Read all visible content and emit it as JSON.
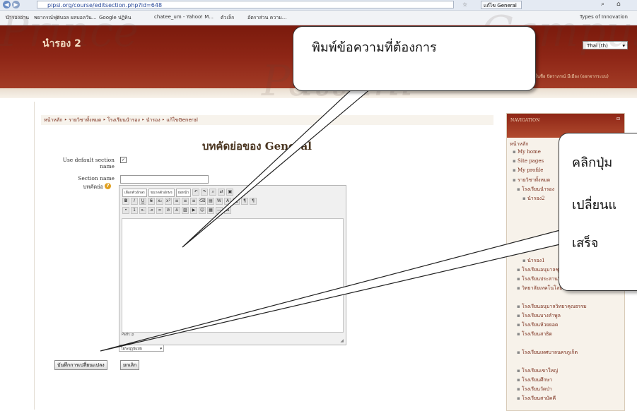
{
  "browser": {
    "address": "pipsi.org/course/editsection.php?id=648",
    "tab_label": "แก้ไข General",
    "bookmarks": [
      "นำรองอ่าน",
      "พยากรณ์ฟุตบอล ผลบอลวัน...",
      "Google ปฏิทิน",
      "chatee_um - Yahoo! M...",
      "ตัวเล็ก",
      "อัตราส่วน ความ...",
      "Types of Innovation"
    ]
  },
  "site": {
    "title": "นำรอง 2",
    "language": "Thai (th)",
    "login_info": "คุณเข้าสู่ระบบในชื่อ ปัดราภรณ์ มีเมือง (ออกจากระบบ)"
  },
  "breadcrumb": [
    "หน้าหลัก",
    "รายวิชาทั้งหมด",
    "โรงเรียนนำรอง",
    "นำรอง",
    "แก้ไขGeneral"
  ],
  "page": {
    "heading": "บทคัดย่อของ General",
    "use_default_label": "Use default section name",
    "section_name_label": "Section name",
    "summary_label": "บทคัดย่อ"
  },
  "editor": {
    "font_family": "เลือกตัวอักษร",
    "font_size": "ขนาดตัวอักษร",
    "paragraph": "ย่อหน้า",
    "path": "Path: p",
    "format": "ไม่ระบุรูปแบบ"
  },
  "buttons": {
    "save": "บันทึกการเปลี่ยนแปลง",
    "cancel": "ยกเลิก"
  },
  "nav": {
    "title": "NAVIGATION",
    "items": [
      "หน้าหลัก",
      "My home",
      "Site pages",
      "My profile",
      "รายวิชาทั้งหมด",
      "โรงเรียนนำรอง",
      "นำรอง2",
      "นำรอง1",
      "โรงเรียนอนุบาลชุมพร",
      "โรงเรียนประสานวิทยาคุณธรรม",
      "วิทยาลัยเทคโนโลยีพาณิชยการ",
      "โรงเรียนอนุบาลวิทยาคุณธรรม",
      "โรงเรียนบางลำพูล",
      "โรงเรียนห้วยยอด",
      "โรงเรียนสาธิต",
      "โรงเรียนเทศบาลนครภูเก็ต",
      "โรงเรียนเขาใหญ่",
      "โรงเรียนศึกษา",
      "โรงเรียนวัดป่า",
      "โรงเรียนสามัคคี"
    ]
  },
  "callouts": {
    "type_hint": "พิมพ์ข้อความที่ต้องการ",
    "save_hint": [
      "คลิกปุ่ม",
      "เปลี่ยนแ",
      "เสร็จ"
    ]
  },
  "watermark": [
    "Prince",
    "Pattani",
    "Campus"
  ],
  "colors": {
    "header": "#8e2616",
    "accent": "#7a2e1c",
    "background": "#ffffff"
  }
}
